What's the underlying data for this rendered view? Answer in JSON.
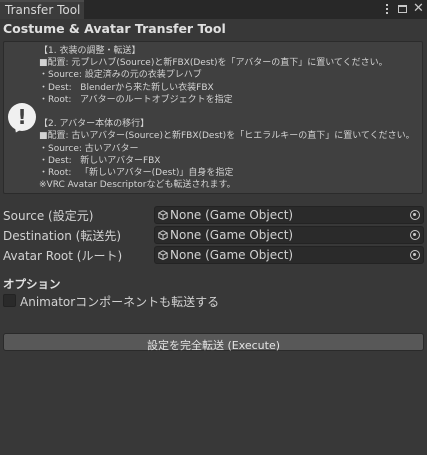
{
  "window": {
    "tab_title": "Transfer Tool",
    "icons": [
      "kebab-menu-icon",
      "maximize-icon",
      "close-icon"
    ]
  },
  "title": "Costume & Avatar Transfer Tool",
  "help": {
    "icon": "info-icon",
    "lines": [
      "【1. 衣装の調整・転送】",
      "■配置: 元プレハブ(Source)と新FBX(Dest)を「アバターの直下」に置いてください。",
      "・Source: 設定済みの元の衣装プレハブ",
      "・Dest:   Blenderから来た新しい衣装FBX",
      "・Root:   アバターのルートオブジェクトを指定",
      "",
      "【2. アバター本体の移行】",
      "■配置: 古いアバター(Source)と新FBX(Dest)を「ヒエラルキーの直下」に置いてください。",
      "・Source: 古いアバター",
      "・Dest:   新しいアバターFBX",
      "・Root:   「新しいアバター(Dest)」自身を指定",
      "※VRC Avatar Descriptorなども転送されます。"
    ]
  },
  "fields": [
    {
      "label": "Source (設定元)",
      "value": "None (Game Object)"
    },
    {
      "label": "Destination (転送先)",
      "value": "None (Game Object)"
    },
    {
      "label": "Avatar Root (ルート)",
      "value": "None (Game Object)"
    }
  ],
  "options": {
    "title": "オプション",
    "transfer_animator_label": "Animatorコンポーネントも転送する",
    "transfer_animator_checked": false
  },
  "execute_button": "設定を完全転送 (Execute)"
}
